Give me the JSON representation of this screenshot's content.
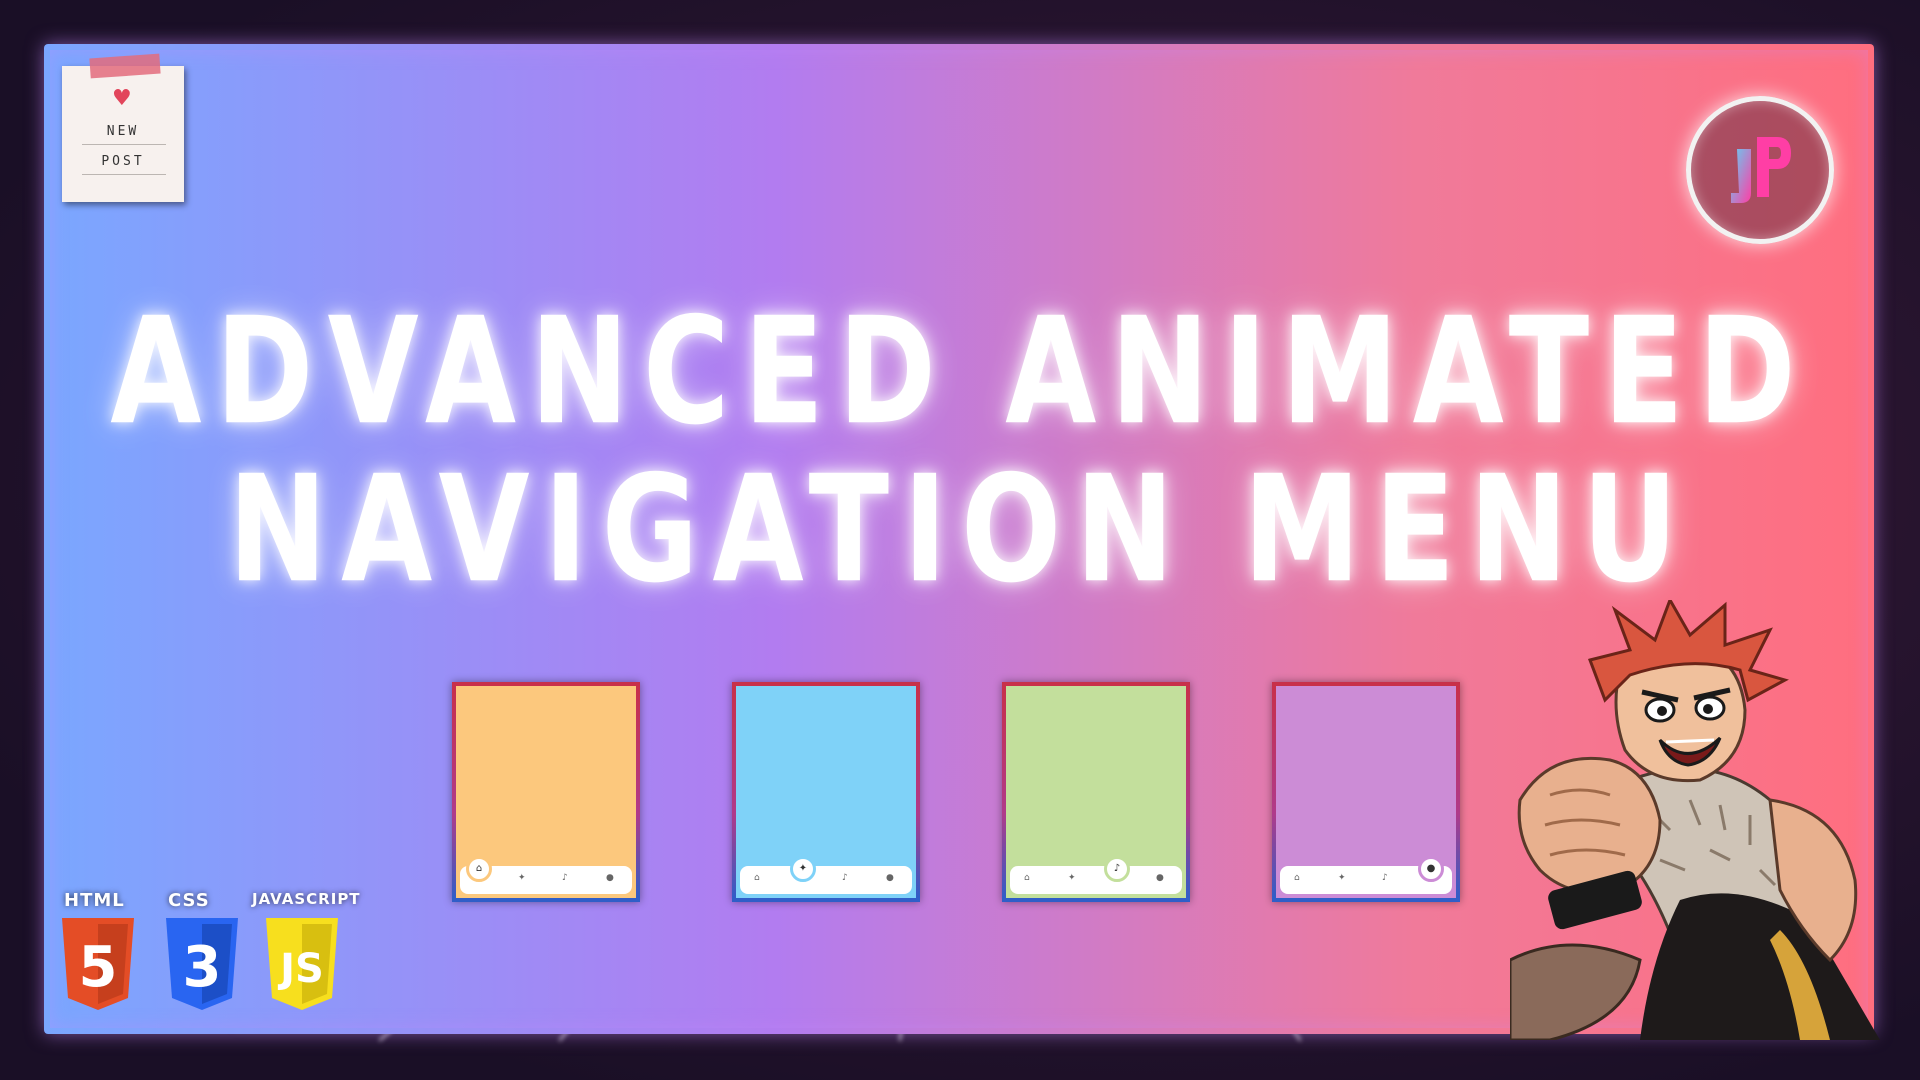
{
  "title": {
    "line1": "ADVANCED ANIMATED",
    "line2": "NAVIGATION MENU"
  },
  "sticky_note": {
    "line1": "NEW",
    "line2": "POST",
    "icon": "heart-icon",
    "tape_color": "#e36c7c"
  },
  "logo": {
    "icon": "jp-logo",
    "left_color": "#5fd3f5",
    "right_color": "#ff3ea5"
  },
  "frame_colors": [
    "#7aa7ff",
    "#b27cf0",
    "#f07a9a",
    "#ff6e7f"
  ],
  "cards": [
    {
      "color": "#fcc87d",
      "active_index": 0,
      "active_icon": "home-icon"
    },
    {
      "color": "#7fd2f8",
      "active_index": 1,
      "active_icon": "twitter-icon"
    },
    {
      "color": "#c3df9c",
      "active_index": 2,
      "active_icon": "bell-icon"
    },
    {
      "color": "#cc8cd6",
      "active_index": 3,
      "active_icon": "user-icon"
    }
  ],
  "nav_icons": [
    "home-icon",
    "twitter-icon",
    "bell-icon",
    "user-icon"
  ],
  "tech": [
    {
      "label": "HTML",
      "number": "5",
      "color": "#e44d26",
      "dark": "#c63f1d"
    },
    {
      "label": "CSS",
      "number": "3",
      "color": "#2965f1",
      "dark": "#1c4fc7"
    },
    {
      "label": "JAVASCRIPT",
      "number": "JS",
      "color": "#f7df1e",
      "dark": "#d8bf10"
    }
  ]
}
